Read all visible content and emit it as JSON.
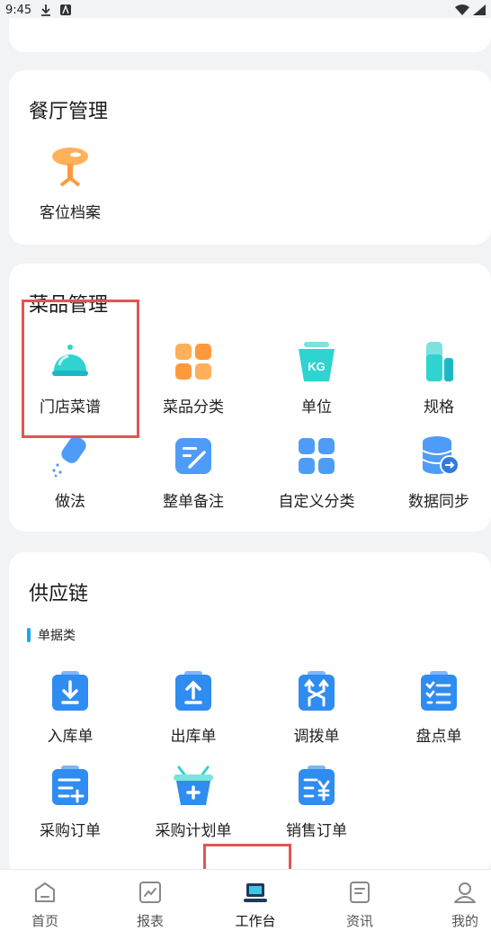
{
  "status_bar": {
    "time": "9:45"
  },
  "restaurant": {
    "title": "餐厅管理",
    "items": [
      {
        "label": "客位档案",
        "icon": "table-icon"
      }
    ]
  },
  "dishes": {
    "title": "菜品管理",
    "items": [
      {
        "label": "门店菜谱",
        "icon": "cloche-icon"
      },
      {
        "label": "菜品分类",
        "icon": "category-grid-icon"
      },
      {
        "label": "单位",
        "icon": "kg-weight-icon"
      },
      {
        "label": "规格",
        "icon": "bottles-icon"
      },
      {
        "label": "做法",
        "icon": "salt-shaker-icon"
      },
      {
        "label": "整单备注",
        "icon": "note-edit-icon"
      },
      {
        "label": "自定义分类",
        "icon": "custom-grid-icon"
      },
      {
        "label": "数据同步",
        "icon": "database-sync-icon"
      }
    ]
  },
  "supply": {
    "title": "供应链",
    "subtitle": "单据类",
    "items": [
      {
        "label": "入库单",
        "icon": "stock-in-icon"
      },
      {
        "label": "出库单",
        "icon": "stock-out-icon"
      },
      {
        "label": "调拨单",
        "icon": "transfer-icon"
      },
      {
        "label": "盘点单",
        "icon": "inventory-check-icon"
      },
      {
        "label": "采购订单",
        "icon": "purchase-order-icon"
      },
      {
        "label": "采购计划单",
        "icon": "purchase-basket-icon"
      },
      {
        "label": "销售订单",
        "icon": "sales-order-icon"
      }
    ]
  },
  "tabs": [
    {
      "label": "首页",
      "icon": "home-icon"
    },
    {
      "label": "报表",
      "icon": "report-icon"
    },
    {
      "label": "工作台",
      "icon": "workbench-icon"
    },
    {
      "label": "资讯",
      "icon": "news-icon"
    },
    {
      "label": "我的",
      "icon": "profile-icon"
    }
  ],
  "colors": {
    "accent_blue": "#2f8cf0",
    "teal": "#2fd3d0",
    "orange": "#ffa04a",
    "highlight_red": "#e05555"
  }
}
